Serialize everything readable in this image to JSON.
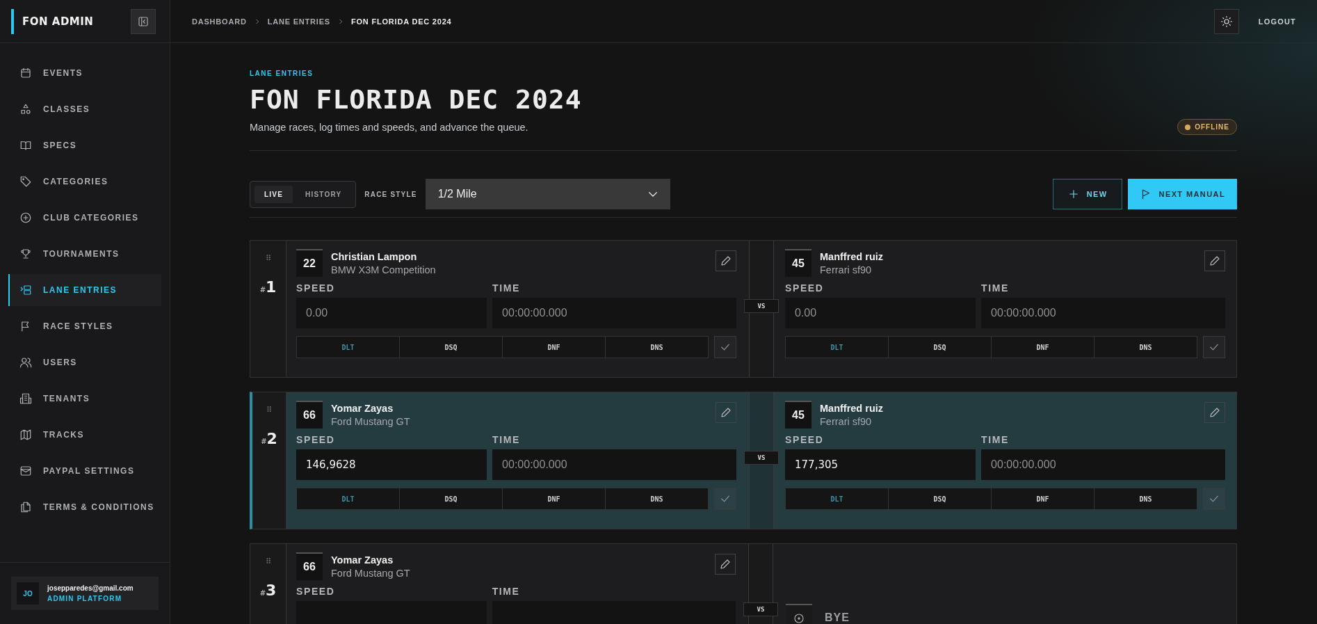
{
  "sidebar": {
    "title": "FON ADMIN",
    "items": [
      {
        "label": "EVENTS",
        "selected": false
      },
      {
        "label": "CLASSES",
        "selected": false
      },
      {
        "label": "SPECS",
        "selected": false
      },
      {
        "label": "CATEGORIES",
        "selected": false
      },
      {
        "label": "CLUB CATEGORIES",
        "selected": false
      },
      {
        "label": "TOURNAMENTS",
        "selected": false
      },
      {
        "label": "LANE ENTRIES",
        "selected": true
      },
      {
        "label": "RACE STYLES",
        "selected": false
      },
      {
        "label": "USERS",
        "selected": false
      },
      {
        "label": "TENANTS",
        "selected": false
      },
      {
        "label": "TRACKS",
        "selected": false
      },
      {
        "label": "PAYPAL SETTINGS",
        "selected": false
      },
      {
        "label": "TERMS & CONDITIONS",
        "selected": false
      }
    ],
    "user": {
      "initials": "JO",
      "email": "josepparedes@gmail.com",
      "role": "ADMIN PLATFORM"
    }
  },
  "breadcrumb": [
    "DASHBOARD",
    "LANE ENTRIES",
    "FON FLORIDA DEC 2024"
  ],
  "logout": "LOGOUT",
  "page": {
    "eyebrow": "LANE ENTRIES",
    "title": "FON FLORIDA DEC 2024",
    "subtitle": "Manage races, log times and speeds, and advance the queue.",
    "status": "OFFLINE"
  },
  "toolbar": {
    "tabs": [
      {
        "label": "LIVE",
        "selected": true
      },
      {
        "label": "HISTORY",
        "selected": false
      }
    ],
    "race_style_label": "RACE STYLE",
    "race_style": "1/2 Mile",
    "new_button": "NEW",
    "next_button": "NEXT MANUAL"
  },
  "races": [
    {
      "number_prefix": "#",
      "number": "1",
      "selected": false,
      "vs": "VS",
      "lanes": [
        {
          "kind": "driver",
          "car_number": "22",
          "driver": "Christian Lampon",
          "car": "BMW X3M Competition",
          "speed_label": "SPEED",
          "time_label": "TIME",
          "speed": {
            "placeholder": "0.00"
          },
          "time": {
            "placeholder": "00:00:00.000"
          },
          "statuses": [
            {
              "label": "DLT",
              "highlighted": true
            },
            {
              "label": "DSQ",
              "highlighted": false
            },
            {
              "label": "DNF",
              "highlighted": false
            },
            {
              "label": "DNS",
              "highlighted": false
            }
          ]
        },
        {
          "kind": "driver",
          "car_number": "45",
          "driver": "Manffred ruiz",
          "car": "Ferrari sf90",
          "speed_label": "SPEED",
          "time_label": "TIME",
          "speed": {
            "placeholder": "0.00"
          },
          "time": {
            "placeholder": "00:00:00.000"
          },
          "statuses": [
            {
              "label": "DLT",
              "highlighted": true
            },
            {
              "label": "DSQ",
              "highlighted": false
            },
            {
              "label": "DNF",
              "highlighted": false
            },
            {
              "label": "DNS",
              "highlighted": false
            }
          ]
        }
      ]
    },
    {
      "number_prefix": "#",
      "number": "2",
      "selected": true,
      "vs": "VS",
      "lanes": [
        {
          "kind": "driver",
          "car_number": "66",
          "driver": "Yomar Zayas",
          "car": "Ford Mustang GT",
          "speed_label": "SPEED",
          "time_label": "TIME",
          "speed": {
            "value": "146,9628"
          },
          "time": {
            "placeholder": "00:00:00.000"
          },
          "statuses": [
            {
              "label": "DLT",
              "highlighted": true
            },
            {
              "label": "DSQ",
              "highlighted": false
            },
            {
              "label": "DNF",
              "highlighted": false
            },
            {
              "label": "DNS",
              "highlighted": false
            }
          ]
        },
        {
          "kind": "driver",
          "car_number": "45",
          "driver": "Manffred ruiz",
          "car": "Ferrari sf90",
          "speed_label": "SPEED",
          "time_label": "TIME",
          "speed": {
            "value": "177,305"
          },
          "time": {
            "placeholder": "00:00:00.000"
          },
          "statuses": [
            {
              "label": "DLT",
              "highlighted": true
            },
            {
              "label": "DSQ",
              "highlighted": false
            },
            {
              "label": "DNF",
              "highlighted": false
            },
            {
              "label": "DNS",
              "highlighted": false
            }
          ]
        }
      ]
    },
    {
      "number_prefix": "#",
      "number": "3",
      "selected": false,
      "vs": "VS",
      "lanes": [
        {
          "kind": "driver",
          "car_number": "66",
          "driver": "Yomar Zayas",
          "car": "Ford Mustang GT",
          "speed_label": "SPEED",
          "time_label": "TIME"
        },
        {
          "kind": "bye",
          "label": "BYE"
        }
      ]
    }
  ]
}
